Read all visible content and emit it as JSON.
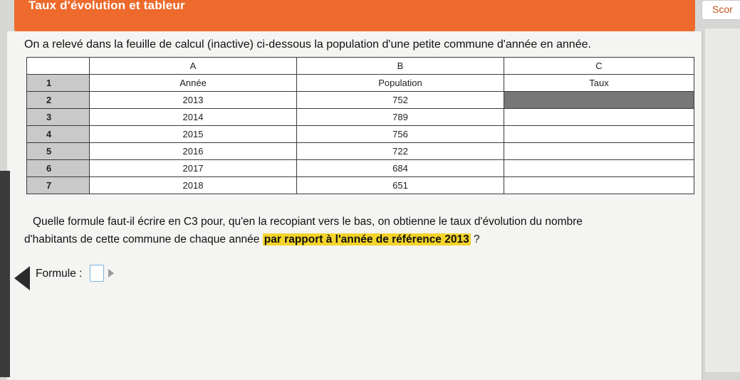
{
  "header": {
    "title": "Taux d'évolution et tableur",
    "score_label": "Scor"
  },
  "exercise": {
    "intro": "On a relevé dans la feuille de calcul (inactive) ci-dessous la population d'une petite commune d'année en année.",
    "question_line1": "Quelle formule faut-il écrire en C3 pour, qu'en la recopiant vers le bas, on obtienne le taux d'évolution du nombre",
    "question_line2_start": "d'habitants de cette commune de chaque année",
    "question_highlight": "par rapport à l'année de référence 2013",
    "question_end": " ?",
    "formula_label": "Formule :",
    "formula_value": ""
  },
  "spreadsheet": {
    "columns": [
      "A",
      "B",
      "C"
    ],
    "rows": [
      {
        "num": "1",
        "a": "Année",
        "b": "Population",
        "c": "Taux"
      },
      {
        "num": "2",
        "a": "2013",
        "b": "752",
        "c": ""
      },
      {
        "num": "3",
        "a": "2014",
        "b": "789",
        "c": ""
      },
      {
        "num": "4",
        "a": "2015",
        "b": "756",
        "c": ""
      },
      {
        "num": "5",
        "a": "2016",
        "b": "722",
        "c": ""
      },
      {
        "num": "6",
        "a": "2017",
        "b": "684",
        "c": ""
      },
      {
        "num": "7",
        "a": "2018",
        "b": "651",
        "c": ""
      }
    ]
  },
  "colors": {
    "header_bg": "#ed6a2c",
    "highlight": "#f4d42a",
    "active_cell": "#777777"
  },
  "icons": [
    "left-arrow-icon",
    "cursor-icon"
  ]
}
